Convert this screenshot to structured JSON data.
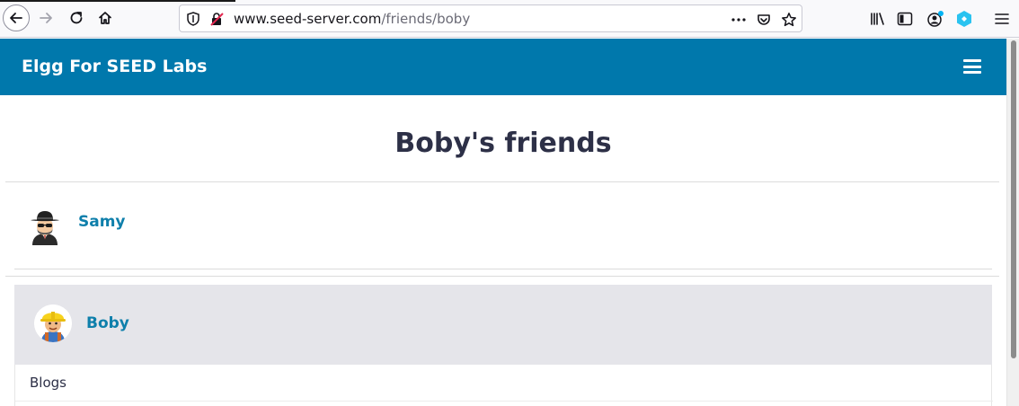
{
  "browser": {
    "url_host": "www.seed-server.com",
    "url_path": "/friends/boby",
    "icons": {
      "back": "back-arrow-icon",
      "forward": "forward-arrow-icon",
      "reload": "reload-icon",
      "home": "home-icon",
      "shield": "tracking-shield-icon",
      "insecure": "insecure-lock-icon",
      "more": "more-actions-icon",
      "pocket": "pocket-icon",
      "bookmark": "bookmark-star-icon",
      "library": "library-icon",
      "sidebar": "sidebar-icon",
      "account": "account-icon",
      "extension": "extension-icon",
      "menu": "hamburger-menu-icon"
    }
  },
  "site": {
    "title": "Elgg For SEED Labs",
    "header_color": "#0078ac"
  },
  "page": {
    "heading": "Boby's friends",
    "friends": [
      {
        "name": "Samy",
        "avatar": "spy-avatar"
      }
    ],
    "owner": {
      "name": "Boby",
      "avatar": "builder-avatar",
      "menu": [
        {
          "label": "Blogs"
        }
      ]
    }
  },
  "colors": {
    "link": "#0e7fab",
    "heading": "#2d3047",
    "owner_bg": "#e5e5ea"
  }
}
